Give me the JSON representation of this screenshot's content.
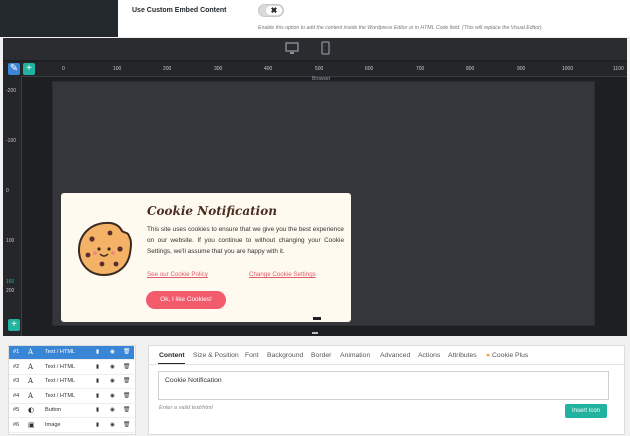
{
  "settings": {
    "embed_label": "Use Custom Embed Content",
    "toggle_off_glyph": "✖",
    "embed_help": "Enable this option to add the content inside the Wordpress Editor or in HTML Code field. (This will replace the Visual Editor)."
  },
  "editor": {
    "devices": [
      "desktop-icon",
      "mobile-icon"
    ],
    "top_ruler": [
      "0",
      "100",
      "200",
      "300",
      "400",
      "500",
      "600",
      "700",
      "800",
      "900",
      "1000",
      "1100"
    ],
    "left_ruler": [
      "-200",
      "-100",
      "0",
      "100",
      "160",
      "200"
    ],
    "canvas_label": "Browser"
  },
  "cookie": {
    "title": "Cookie Notification",
    "text": "This site uses cookies to ensure that we give you the best experience on our website. If you continue to without changing your Cookie Settings, we'll assume that you are happy with it.",
    "link_policy": "See our Cookie Policy",
    "link_settings": "Change Cookie Settings",
    "button": "Ok, I like Cookies!"
  },
  "layers": [
    {
      "num": "#1",
      "name": "Text / HTML",
      "icon": "text-icon",
      "active": true
    },
    {
      "num": "#2",
      "name": "Text / HTML",
      "icon": "text-icon",
      "active": false
    },
    {
      "num": "#3",
      "name": "Text / HTML",
      "icon": "text-icon",
      "active": false
    },
    {
      "num": "#4",
      "name": "Text / HTML",
      "icon": "text-icon",
      "active": false
    },
    {
      "num": "#5",
      "name": "Button",
      "icon": "button-icon",
      "active": false
    },
    {
      "num": "#6",
      "name": "Image",
      "icon": "image-icon",
      "active": false
    }
  ],
  "panel": {
    "tabs": [
      "Content",
      "Size & Position",
      "Font",
      "Background",
      "Border",
      "Animation",
      "Advanced",
      "Actions",
      "Attributes",
      "Cookie Plus"
    ],
    "textarea_value": "Cookie Notification",
    "hint": "Enter a valid text/html",
    "insert_button": "Insert Icon"
  },
  "colors": {
    "accent_teal": "#22b2a0",
    "active_layer": "#3a86d6",
    "cookie_button": "#f25b6c",
    "link": "#e05b69"
  }
}
